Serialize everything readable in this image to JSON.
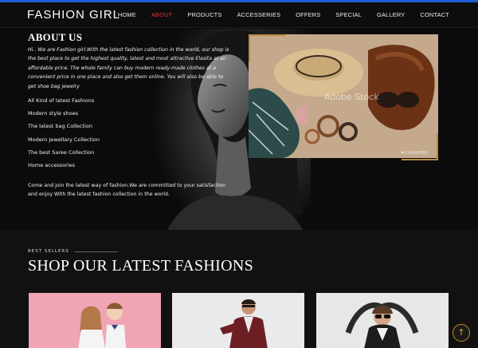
{
  "header": {
    "brand": "FASHION GIRL",
    "nav": [
      {
        "label": "HOME",
        "active": false
      },
      {
        "label": "ABOUT",
        "active": true
      },
      {
        "label": "PRODUCTS",
        "active": false
      },
      {
        "label": "ACCESSERIES",
        "active": false
      },
      {
        "label": "OFFERS",
        "active": false
      },
      {
        "label": "SPECIAL",
        "active": false
      },
      {
        "label": "GALLERY",
        "active": false
      },
      {
        "label": "CONTACT",
        "active": false
      }
    ]
  },
  "about": {
    "title": "ABOUT US",
    "intro": "Hi.. We are Fashion girl.With the latest fashion collection in the world, our shop is the best place to get the highest quality, latest and most attractive Elasita at an affordable price. The whole family can buy modern ready-made clothes at a convenient price in one place and also get them online. You will also be able to get shoe bag jewelry",
    "list": [
      "All Kind of latest Fashions",
      "Modern style shoes",
      "The latest bag Collection",
      "Modern Jewellary Collection",
      "The best Saree Collection",
      "Home accessories"
    ],
    "footer": "Come and join the latest way of fashion.We are committed to your satisfaction and enjoy With the latest fashion collection in the world.",
    "photo_id": "#110244359",
    "photo_watermark": "Adobe Stock"
  },
  "best_sellers": {
    "eyebrow": "BEST SELLERS",
    "title": "SHOP OUR LATEST FASHIONS"
  },
  "colors": {
    "accent": "#e0362c",
    "gold": "#b68c3d",
    "top_line": "#1f5fd6"
  },
  "icons": {
    "back_to_top": "arrow-up-icon"
  }
}
